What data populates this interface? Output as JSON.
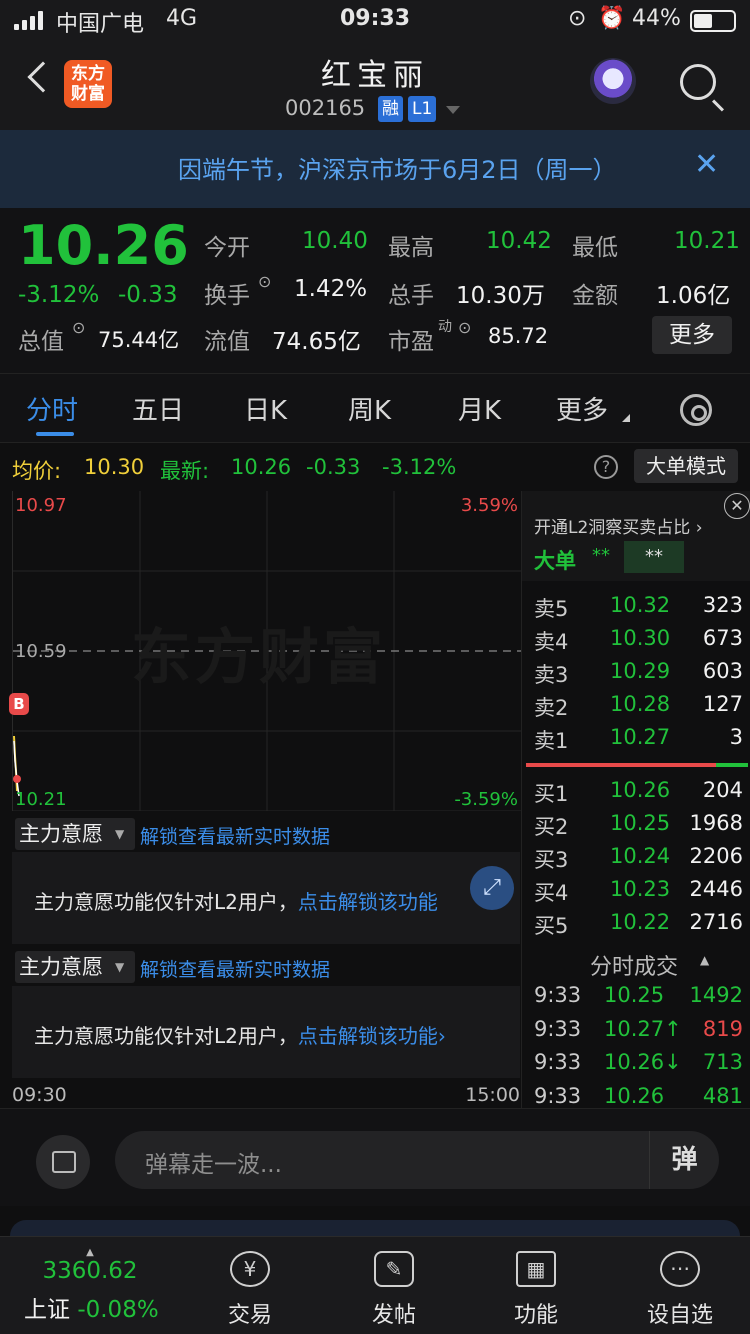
{
  "status_bar": {
    "carrier": "中国广电",
    "network": "4G",
    "time": "09:33",
    "battery": "44%"
  },
  "header": {
    "title": "红宝丽",
    "code": "002165",
    "tag_rong": "融",
    "tag_l1": "L1",
    "logo": "东方\n财富"
  },
  "notice": {
    "text": "因端午节，沪深京市场于6月2日（周一）"
  },
  "quote": {
    "price": "10.26",
    "change_pct": "-3.12%",
    "change": "-0.33",
    "open_label": "今开",
    "open": "10.40",
    "high_label": "最高",
    "high": "10.42",
    "low_label": "最低",
    "low": "10.21",
    "turnover_label": "换手",
    "turnover": "1.42%",
    "volume_label": "总手",
    "volume": "10.30万",
    "amount_label": "金额",
    "amount": "1.06亿",
    "mktcap_label": "总值",
    "mktcap": "75.44亿",
    "float_label": "流值",
    "float": "74.65亿",
    "pe_label": "市盈",
    "pe_sup": "动",
    "pe": "85.72",
    "more": "更多"
  },
  "tabs": [
    "分时",
    "五日",
    "日K",
    "周K",
    "月K",
    "更多"
  ],
  "avg_row": {
    "avg_label": "均价:",
    "avg": "10.30",
    "last_label": "最新:",
    "last": "10.26",
    "chg": "-0.33",
    "pct": "-3.12%",
    "big_order": "大单模式"
  },
  "chart": {
    "top": "10.97",
    "top_pct": "3.59%",
    "mid": "10.59",
    "bottom": "10.21",
    "bottom_pct": "-3.59%",
    "watermark": "东方财富",
    "marker": "B",
    "start": "09:30",
    "end": "15:00"
  },
  "l2": {
    "select": "主力意愿",
    "link": "解锁查看最新实时数据",
    "msg": "主力意愿功能仅针对L2用户，",
    "msg_link": "点击解锁该功能"
  },
  "book": {
    "promo": "开通L2洞察买卖占比 ›",
    "big_label": "大单",
    "big_val1": "**",
    "big_val2": "**",
    "asks": [
      {
        "label": "卖5",
        "price": "10.32",
        "vol": "323"
      },
      {
        "label": "卖4",
        "price": "10.30",
        "vol": "673"
      },
      {
        "label": "卖3",
        "price": "10.29",
        "vol": "603"
      },
      {
        "label": "卖2",
        "price": "10.28",
        "vol": "127"
      },
      {
        "label": "卖1",
        "price": "10.27",
        "vol": "3"
      }
    ],
    "bids": [
      {
        "label": "买1",
        "price": "10.26",
        "vol": "204"
      },
      {
        "label": "买2",
        "price": "10.25",
        "vol": "1968"
      },
      {
        "label": "买3",
        "price": "10.24",
        "vol": "2206"
      },
      {
        "label": "买4",
        "price": "10.23",
        "vol": "2446"
      },
      {
        "label": "买5",
        "price": "10.22",
        "vol": "2716"
      }
    ],
    "trades_title": "分时成交",
    "trades": [
      {
        "time": "9:33",
        "price": "10.25",
        "vol": "1492"
      },
      {
        "time": "9:33",
        "price": "10.27↑",
        "vol": "819"
      },
      {
        "time": "9:33",
        "price": "10.26↓",
        "vol": "713"
      },
      {
        "time": "9:33",
        "price": "10.26",
        "vol": "481"
      }
    ]
  },
  "comment": {
    "placeholder": "弹幕走一波...",
    "button": "弹"
  },
  "nav": {
    "index_value": "3360.62",
    "index_name": "上证",
    "index_pct": "-0.08%",
    "items": [
      "交易",
      "发帖",
      "功能",
      "设自选"
    ]
  }
}
